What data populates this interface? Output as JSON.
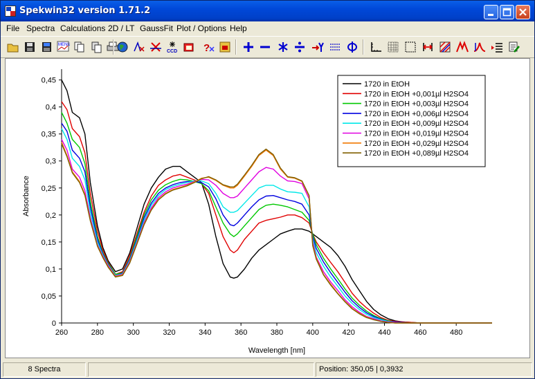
{
  "window": {
    "title": "Spekwin32 version 1.71.2"
  },
  "menu": [
    "File",
    "Spectra",
    "Calculations",
    "2D / LT",
    "GaussFit",
    "Plot / Options",
    "Help"
  ],
  "toolbar_icons": [
    "open-file-icon",
    "save-icon",
    "save-all-icon",
    "menu-icon",
    "chart-icon",
    "copy-icon",
    "print-icon",
    "globe-icon",
    "peak-icon",
    "baseline-icon",
    "ccd-icon",
    "spectrum-icon",
    "help-icon",
    "export-icon",
    "add-icon",
    "subtract-icon",
    "multiply-icon",
    "divide-icon",
    "derivative-icon",
    "integrate-icon",
    "phi-icon",
    "axis-icon",
    "grid-icon",
    "frame-icon",
    "range-icon",
    "hatch-icon",
    "peak-fit-icon",
    "gauss-icon",
    "list-icon",
    "settings-icon"
  ],
  "status": {
    "count": "8 Spectra",
    "middle": "",
    "position": "Position: 350,05  |  0,3932"
  },
  "colors": {
    "titlebar": "#0048D8",
    "background": "#ECE9D8"
  },
  "chart_data": {
    "type": "line",
    "xlabel": "Wavelength [nm]",
    "ylabel": "Absorbance",
    "xlim": [
      260,
      500
    ],
    "ylim": [
      0,
      0.47
    ],
    "xticks": [
      260,
      280,
      300,
      320,
      340,
      360,
      380,
      400,
      420,
      440,
      460,
      480
    ],
    "xtick_labels": [
      "260",
      "280",
      "300",
      "320",
      "340",
      "360",
      "380",
      "400",
      "420",
      "440",
      "460",
      "480"
    ],
    "yticks": [
      0,
      0.05,
      0.1,
      0.15,
      0.2,
      0.25,
      0.3,
      0.35,
      0.4,
      0.45
    ],
    "ytick_labels": [
      "0",
      "0,05",
      "0,1",
      "0,15",
      "0,2",
      "0,25",
      "0,3",
      "0,35",
      "0,4",
      "0,45"
    ],
    "legend_position": "top-right",
    "x": [
      260,
      263,
      266,
      270,
      273,
      276,
      280,
      283,
      286,
      290,
      294,
      298,
      302,
      306,
      310,
      314,
      318,
      322,
      326,
      330,
      334,
      338,
      342,
      346,
      350,
      354,
      356,
      358,
      362,
      366,
      370,
      374,
      378,
      382,
      386,
      390,
      394,
      398,
      400,
      402,
      406,
      410,
      414,
      418,
      422,
      426,
      430,
      434,
      438,
      442,
      446,
      450,
      455,
      460,
      470,
      480,
      500
    ],
    "series": [
      {
        "name": "1720 in EtOH",
        "color": "#000000",
        "values": [
          0.45,
          0.43,
          0.39,
          0.38,
          0.35,
          0.26,
          0.18,
          0.14,
          0.115,
          0.095,
          0.1,
          0.13,
          0.175,
          0.22,
          0.25,
          0.27,
          0.285,
          0.29,
          0.29,
          0.28,
          0.27,
          0.26,
          0.22,
          0.16,
          0.11,
          0.085,
          0.083,
          0.085,
          0.1,
          0.12,
          0.135,
          0.145,
          0.155,
          0.165,
          0.17,
          0.174,
          0.174,
          0.17,
          0.165,
          0.16,
          0.15,
          0.14,
          0.125,
          0.105,
          0.08,
          0.06,
          0.04,
          0.025,
          0.015,
          0.008,
          0.004,
          0.002,
          0.001,
          0,
          0,
          0,
          0
        ]
      },
      {
        "name": "1720 in EtOH +0,001µl H2SO4",
        "color": "#E00000",
        "values": [
          0.41,
          0.395,
          0.36,
          0.345,
          0.315,
          0.24,
          0.17,
          0.135,
          0.112,
          0.09,
          0.095,
          0.125,
          0.165,
          0.205,
          0.235,
          0.255,
          0.265,
          0.272,
          0.275,
          0.27,
          0.265,
          0.258,
          0.24,
          0.2,
          0.16,
          0.135,
          0.13,
          0.135,
          0.155,
          0.17,
          0.185,
          0.19,
          0.193,
          0.196,
          0.2,
          0.2,
          0.195,
          0.185,
          0.165,
          0.15,
          0.13,
          0.112,
          0.095,
          0.075,
          0.055,
          0.04,
          0.028,
          0.018,
          0.01,
          0.005,
          0.003,
          0.002,
          0.001,
          0,
          0,
          0,
          0
        ]
      },
      {
        "name": "1720 in EtOH +0,003µl H2SO4",
        "color": "#00C800",
        "values": [
          0.39,
          0.37,
          0.34,
          0.325,
          0.295,
          0.225,
          0.16,
          0.13,
          0.11,
          0.09,
          0.093,
          0.12,
          0.16,
          0.2,
          0.228,
          0.246,
          0.256,
          0.262,
          0.266,
          0.265,
          0.262,
          0.258,
          0.245,
          0.215,
          0.185,
          0.165,
          0.16,
          0.165,
          0.18,
          0.195,
          0.21,
          0.218,
          0.22,
          0.218,
          0.215,
          0.21,
          0.205,
          0.19,
          0.165,
          0.145,
          0.12,
          0.1,
          0.082,
          0.063,
          0.046,
          0.033,
          0.022,
          0.014,
          0.008,
          0.004,
          0.002,
          0.001,
          0,
          0,
          0,
          0,
          0
        ]
      },
      {
        "name": "1720 in EtOH +0,006µl H2SO4",
        "color": "#0000E0",
        "values": [
          0.37,
          0.355,
          0.32,
          0.305,
          0.28,
          0.215,
          0.155,
          0.128,
          0.108,
          0.088,
          0.092,
          0.118,
          0.155,
          0.195,
          0.222,
          0.24,
          0.25,
          0.256,
          0.26,
          0.262,
          0.262,
          0.26,
          0.252,
          0.23,
          0.2,
          0.182,
          0.18,
          0.185,
          0.2,
          0.215,
          0.228,
          0.235,
          0.236,
          0.232,
          0.228,
          0.225,
          0.22,
          0.2,
          0.16,
          0.138,
          0.113,
          0.093,
          0.075,
          0.057,
          0.041,
          0.029,
          0.019,
          0.012,
          0.007,
          0.003,
          0.002,
          0.001,
          0,
          0,
          0,
          0,
          0
        ]
      },
      {
        "name": "1720 in EtOH +0,009µl H2SO4",
        "color": "#00E8E8",
        "values": [
          0.36,
          0.34,
          0.305,
          0.29,
          0.265,
          0.205,
          0.15,
          0.126,
          0.107,
          0.088,
          0.091,
          0.116,
          0.152,
          0.19,
          0.218,
          0.236,
          0.247,
          0.253,
          0.257,
          0.26,
          0.263,
          0.263,
          0.258,
          0.24,
          0.215,
          0.205,
          0.205,
          0.208,
          0.222,
          0.236,
          0.25,
          0.255,
          0.255,
          0.248,
          0.243,
          0.242,
          0.24,
          0.215,
          0.155,
          0.13,
          0.105,
          0.085,
          0.068,
          0.05,
          0.036,
          0.025,
          0.016,
          0.01,
          0.006,
          0.003,
          0.001,
          0,
          0,
          0,
          0,
          0,
          0
        ]
      },
      {
        "name": "1720 in EtOH +0,019µl H2SO4",
        "color": "#E000E0",
        "values": [
          0.34,
          0.32,
          0.285,
          0.27,
          0.245,
          0.195,
          0.145,
          0.124,
          0.106,
          0.087,
          0.09,
          0.114,
          0.149,
          0.186,
          0.213,
          0.232,
          0.243,
          0.25,
          0.254,
          0.257,
          0.262,
          0.266,
          0.265,
          0.255,
          0.24,
          0.232,
          0.232,
          0.235,
          0.25,
          0.265,
          0.28,
          0.288,
          0.285,
          0.272,
          0.263,
          0.262,
          0.258,
          0.23,
          0.15,
          0.122,
          0.095,
          0.076,
          0.06,
          0.043,
          0.03,
          0.02,
          0.012,
          0.008,
          0.004,
          0.002,
          0.001,
          0,
          0,
          0,
          0,
          0,
          0
        ]
      },
      {
        "name": "1720 in EtOH +0,029µl H2SO4",
        "color": "#F07800",
        "values": [
          0.335,
          0.31,
          0.28,
          0.262,
          0.238,
          0.19,
          0.143,
          0.122,
          0.104,
          0.086,
          0.089,
          0.112,
          0.147,
          0.183,
          0.21,
          0.229,
          0.24,
          0.247,
          0.251,
          0.255,
          0.261,
          0.268,
          0.27,
          0.264,
          0.255,
          0.25,
          0.25,
          0.255,
          0.272,
          0.29,
          0.31,
          0.32,
          0.31,
          0.285,
          0.27,
          0.268,
          0.262,
          0.235,
          0.145,
          0.12,
          0.09,
          0.072,
          0.055,
          0.04,
          0.027,
          0.018,
          0.011,
          0.006,
          0.003,
          0.001,
          0,
          0,
          0,
          0,
          0,
          0,
          0
        ]
      },
      {
        "name": "1720 in EtOH +0,089µl H2SO4",
        "color": "#806000",
        "values": [
          0.332,
          0.308,
          0.278,
          0.26,
          0.236,
          0.189,
          0.142,
          0.121,
          0.103,
          0.085,
          0.088,
          0.111,
          0.146,
          0.182,
          0.209,
          0.228,
          0.239,
          0.246,
          0.25,
          0.254,
          0.26,
          0.267,
          0.271,
          0.265,
          0.256,
          0.252,
          0.252,
          0.257,
          0.274,
          0.292,
          0.312,
          0.322,
          0.312,
          0.287,
          0.271,
          0.269,
          0.263,
          0.236,
          0.143,
          0.118,
          0.089,
          0.07,
          0.054,
          0.039,
          0.026,
          0.017,
          0.01,
          0.006,
          0.003,
          0.001,
          0,
          0,
          0,
          0,
          0,
          0,
          0
        ]
      }
    ]
  }
}
